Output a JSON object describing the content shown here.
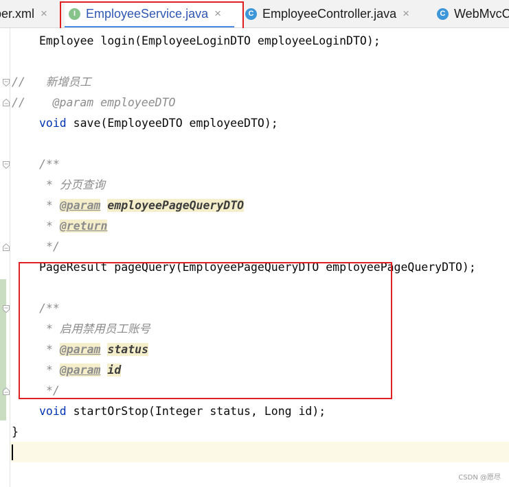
{
  "tabs": [
    {
      "label": "per.xml",
      "icon": "xml-file-icon",
      "active": false
    },
    {
      "label": "EmployeeService.java",
      "icon": "interface-file-icon",
      "icon_glyph": "I",
      "active": true
    },
    {
      "label": "EmployeeController.java",
      "icon": "class-file-icon",
      "icon_glyph": "C",
      "active": false
    },
    {
      "label": "WebMvcC",
      "icon": "class-file-icon",
      "icon_glyph": "C",
      "active": false
    }
  ],
  "tab_close_glyph": "×",
  "code": {
    "line_login": {
      "type": "Employee",
      "rest": " login(EmployeeLoginDTO employeeLoginDTO);"
    },
    "line_c1": {
      "slashes": "//",
      "text": "新增员工"
    },
    "line_c2": {
      "slashes": "//",
      "text": "@param employeeDTO"
    },
    "line_save": {
      "kw": "void",
      "rest": " save(EmployeeDTO employeeDTO);"
    },
    "doc1_open": "/**",
    "doc1_title": "分页查询",
    "doc1_param_tag": "@param",
    "doc1_param_name": "employeePageQueryDTO",
    "doc1_return_tag": "@return",
    "doc_star": "*",
    "doc_close": "*/",
    "line_pagequery": "PageResult pageQuery(EmployeePageQueryDTO employeePageQueryDTO);",
    "doc2_open": "/**",
    "doc2_title": "启用禁用员工账号",
    "doc2_param1_tag": "@param",
    "doc2_param1_name": "status",
    "doc2_param2_tag": "@param",
    "doc2_param2_name": "id",
    "line_startstop": {
      "kw": "void",
      "rest": " startOrStop(Integer status, Long id);"
    },
    "closing_brace": "}"
  },
  "watermark": "CSDN @愿尽",
  "colors": {
    "keyword": "#0033b3",
    "comment": "#8c8c8c",
    "highlight_box": "#e02020",
    "active_tab_text": "#2f57b3",
    "tab_underline": "#4a88e5"
  }
}
